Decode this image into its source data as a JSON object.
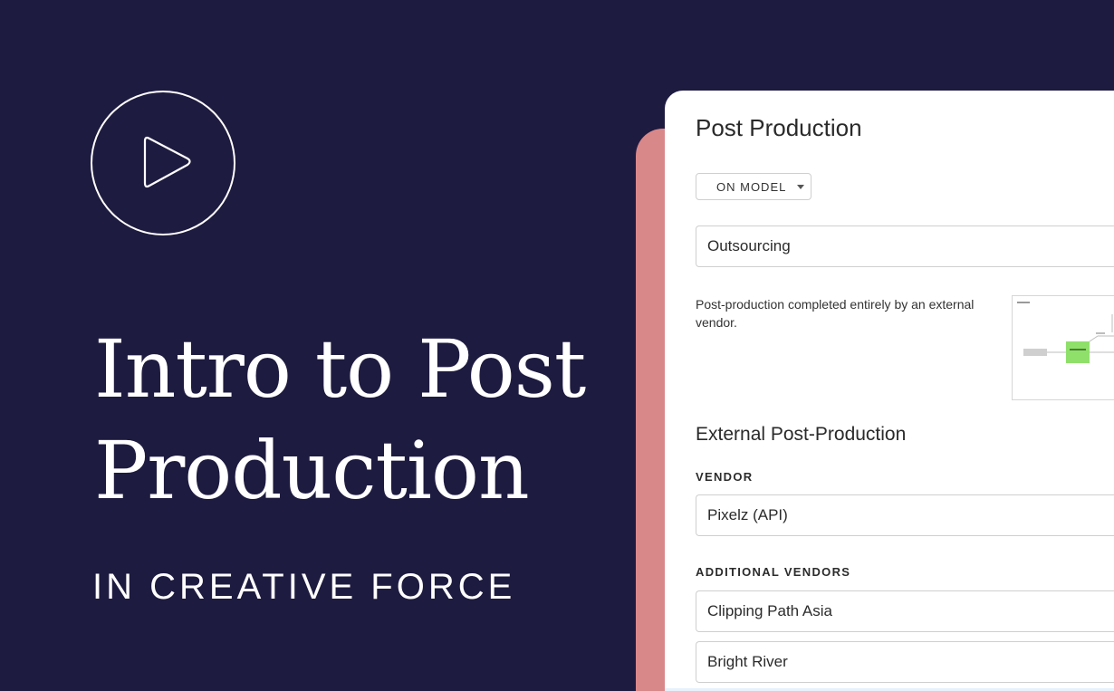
{
  "hero": {
    "play_icon": "play-icon",
    "title_line1": "Intro to Post",
    "title_line2": "Production",
    "subtitle": "IN CREATIVE FORCE"
  },
  "colors": {
    "background": "#1e1b40",
    "accent": "#d9888a",
    "panel": "#ffffff",
    "diagram_node_green": "#8fe06a"
  },
  "panel": {
    "title": "Post Production",
    "mode_dropdown": {
      "selected": "ON MODEL",
      "icon": "chevron-down-icon"
    },
    "workflow_select": {
      "value": "Outsourcing"
    },
    "description": "Post-production completed entirely by an external vendor.",
    "external_section": {
      "title": "External Post-Production",
      "vendor_label": "VENDOR",
      "vendor_value": "Pixelz (API)",
      "additional_label": "ADDITIONAL VENDORS",
      "additional_vendors": [
        "Clipping Path Asia",
        "Bright River"
      ]
    }
  }
}
